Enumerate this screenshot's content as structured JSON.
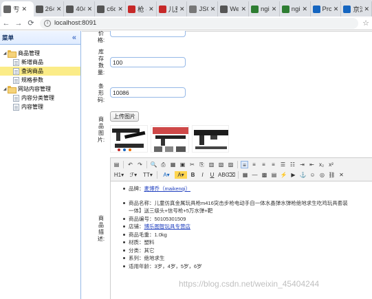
{
  "browser": {
    "tabs": [
      {
        "label": "亐",
        "icon_color": "#666666",
        "active": true
      },
      {
        "label": "264",
        "icon_color": "#555555"
      },
      {
        "label": "404",
        "icon_color": "#555555"
      },
      {
        "label": "c6d",
        "icon_color": "#555555"
      },
      {
        "label": "枪 -",
        "icon_color": "#c62828"
      },
      {
        "label": "儿童",
        "icon_color": "#c62828"
      },
      {
        "label": "JSO",
        "icon_color": "#777777"
      },
      {
        "label": "We",
        "icon_color": "#555555"
      },
      {
        "label": "ngi",
        "icon_color": "#2e7d32"
      },
      {
        "label": "ngi",
        "icon_color": "#2e7d32"
      },
      {
        "label": "Pro",
        "icon_color": "#1565c0"
      },
      {
        "label": "京涛",
        "icon_color": "#1565c0"
      }
    ],
    "url": "localhost:8091"
  },
  "sidebar": {
    "title": "菜单",
    "collapse_glyph": "«",
    "tree": [
      {
        "label": "商品管理",
        "type": "folder",
        "level": 0
      },
      {
        "label": "新增商品",
        "type": "file",
        "level": 1
      },
      {
        "label": "查询商品",
        "type": "file",
        "level": 1,
        "selected": true
      },
      {
        "label": "规格参数",
        "type": "file",
        "level": 1
      },
      {
        "label": "网站内容管理",
        "type": "folder",
        "level": 0
      },
      {
        "label": "内容分类管理",
        "type": "file",
        "level": 1
      },
      {
        "label": "内容管理",
        "type": "file",
        "level": 1
      }
    ]
  },
  "form": {
    "price_label_tail": "价格:",
    "stock_label": "库存数量:",
    "stock_value": "100",
    "barcode_label": "条形码:",
    "barcode_value": "10086",
    "image_label": "商品图片:",
    "upload_button": "上传图片",
    "desc_label": "商品描述:"
  },
  "editor": {
    "content": [
      {
        "prefix": "品牌：",
        "link": "麦博乔（maikenqi）",
        "gap_after": true
      },
      {
        "text": "商品名称：儿童仿真金属玩具枪m416突击步枪电动手自一体水晶弹水弹枪绝地求生吃鸡玩具套装"
      },
      {
        "text": "一体】送三级头+信号枪+5万水弹+靶",
        "indent": true
      },
      {
        "text": "商品编号：50105301509"
      },
      {
        "prefix": "店铺：",
        "link": "博乐图智玩具专营店"
      },
      {
        "text": "商品毛重：1.0kg"
      },
      {
        "text": "材质：塑料"
      },
      {
        "text": "分类：其它"
      },
      {
        "text": "系列：绝地求生"
      },
      {
        "text": "适用年龄：3岁，4岁，5岁，6岁"
      }
    ]
  },
  "watermark": "https://blog.csdn.net/weixin_45404244"
}
